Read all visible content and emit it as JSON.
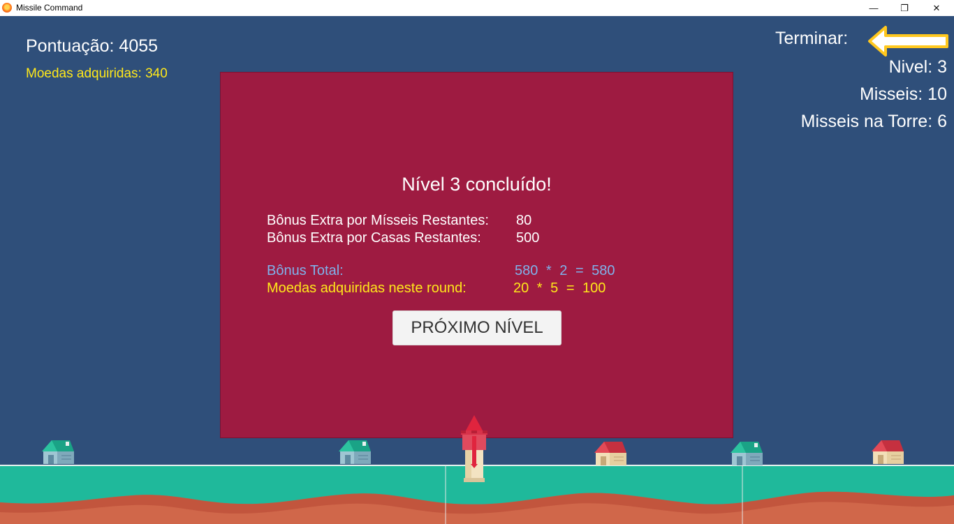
{
  "window": {
    "title": "Missile Command",
    "minimize_glyph": "—",
    "restore_glyph": "❐",
    "close_glyph": "✕"
  },
  "hud": {
    "score": "Pontuação: 4055",
    "coins": "Moedas adquiridas: 340",
    "quit_label": "Terminar:",
    "level": "Nivel: 3",
    "missiles": "Misseis: 10",
    "tower_missiles": "Misseis na Torre: 6"
  },
  "summary": {
    "title": "Nível 3 concluído!",
    "missiles_bonus_label": "Bônus Extra por Mísseis Restantes:",
    "missiles_bonus_value": "80",
    "houses_bonus_label": "Bônus Extra por Casas Restantes:",
    "houses_bonus_value": "500",
    "total_label": "Bônus Total:",
    "total_value": "580  *  2  =  580",
    "round_coins_label": "Moedas adquiridas neste round:",
    "round_coins_value": "20  *  5  =  100",
    "next_button": "PRÓXIMO NÍVEL"
  },
  "icons": {
    "quit": "arrow-left-icon",
    "tower": "missile-tower-icon",
    "house": "house-icon"
  },
  "colors": {
    "background": "#2f4f7a",
    "panel": "#9e1b41",
    "coins_text": "#ffe81a",
    "total_text": "#7fb2ea",
    "grass": "#1fb99b",
    "dirt": "#d0674a"
  }
}
